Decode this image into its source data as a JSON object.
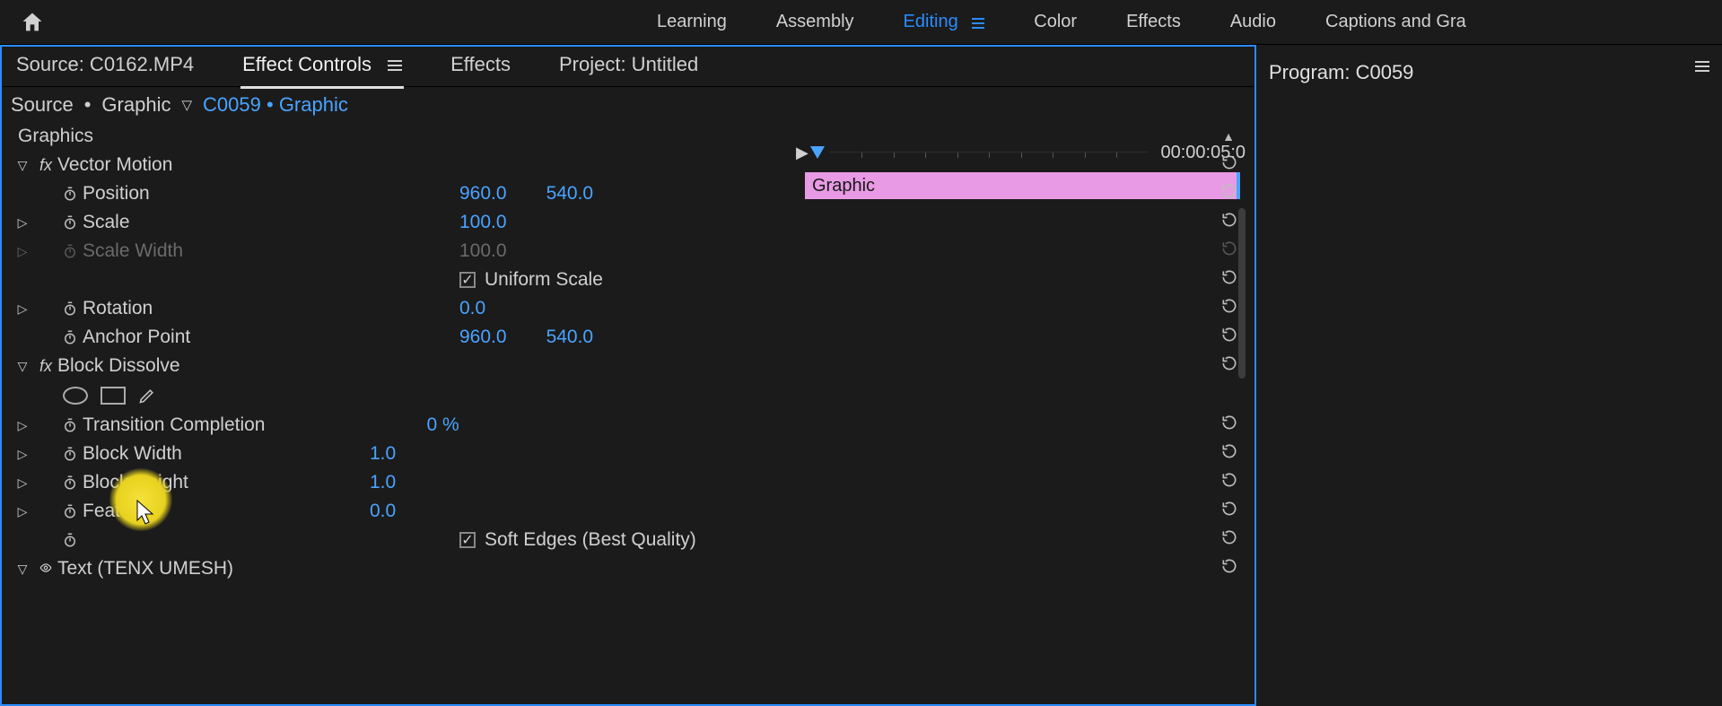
{
  "workspaces": {
    "items": [
      "Learning",
      "Assembly",
      "Editing",
      "Color",
      "Effects",
      "Audio",
      "Captions and Gra"
    ],
    "active": 2
  },
  "panel_tabs": {
    "items": [
      "Source: C0162.MP4",
      "Effect Controls",
      "Effects",
      "Project: Untitled"
    ],
    "active": 1
  },
  "program_panel": "Program: C0059",
  "breadcrumb": {
    "source_label": "Source",
    "source_item": "Graphic",
    "sequence": "C0059",
    "sequence_item": "Graphic"
  },
  "timecode": "00:00:05:0",
  "clip_label": "Graphic",
  "section_header": "Graphics",
  "effects": {
    "vector_motion": {
      "label": "Vector Motion",
      "position": {
        "label": "Position",
        "x": "960.0",
        "y": "540.0"
      },
      "scale": {
        "label": "Scale",
        "v": "100.0"
      },
      "scale_width": {
        "label": "Scale Width",
        "v": "100.0"
      },
      "uniform_scale": {
        "label": "Uniform Scale",
        "checked": true
      },
      "rotation": {
        "label": "Rotation",
        "v": "0.0"
      },
      "anchor_point": {
        "label": "Anchor Point",
        "x": "960.0",
        "y": "540.0"
      }
    },
    "block_dissolve": {
      "label": "Block Dissolve",
      "transition_completion": {
        "label": "Transition Completion",
        "v": "0 %"
      },
      "block_width": {
        "label": "Block Width",
        "v": "1.0"
      },
      "block_height": {
        "label": "Block Height",
        "v": "1.0"
      },
      "feather": {
        "label": "Feather",
        "v": "0.0"
      },
      "soft_edges": {
        "label": "Soft Edges (Best Quality)",
        "checked": true
      }
    },
    "text": {
      "label": "Text (TENX UMESH)"
    }
  }
}
